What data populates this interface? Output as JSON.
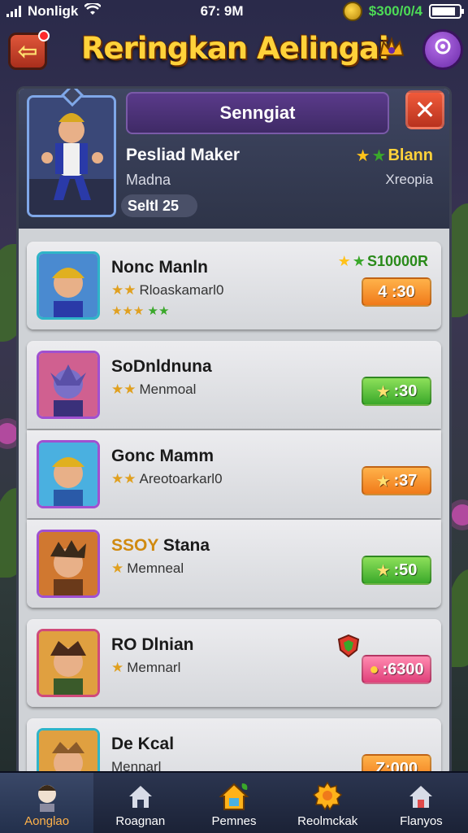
{
  "status_bar": {
    "carrier": "Nonligk",
    "time": "67: 9M",
    "currency": "$300/0/4"
  },
  "header": {
    "title": "Reringkan Aelingai"
  },
  "profile": {
    "banner_name": "Senngiat",
    "title": "Pesliad Maker",
    "subtitle": "Madna",
    "level": "Seltl 25",
    "rank": "Blann",
    "rank_sub": "Xreopia"
  },
  "list": [
    {
      "name": "Nonc Manln",
      "sub": "Rloaskamarl0",
      "timer": "4 :30",
      "timer_color": "orange",
      "reward": "S10000R",
      "frame": "#2fb4c8"
    },
    {
      "name": "SoDnldnuna",
      "sub": "Menmoal",
      "timer": ":30",
      "timer_color": "green",
      "frame": "#a050d0"
    },
    {
      "name": "Gonc Mamm",
      "sub": "Areotoarkarl0",
      "timer": ":37",
      "timer_color": "orange",
      "frame": "#a050d0"
    },
    {
      "name": "Stana",
      "name_prefix": "SSOY",
      "sub": "Memneal",
      "timer": ":50",
      "timer_color": "green",
      "frame": "#a050d0"
    },
    {
      "name": "Dlnian",
      "name_prefix": "RO",
      "sub": "Memnarl",
      "timer": ":6300",
      "timer_color": "pink",
      "frame": "#d04a7a"
    },
    {
      "name": "De Kcal",
      "sub": "Mennarl",
      "timer": "Z:000",
      "timer_color": "orange",
      "frame": "#2fb4c8"
    }
  ],
  "nav": [
    {
      "label": "Aonglao",
      "icon": "avatar-icon"
    },
    {
      "label": "Roagnan",
      "icon": "home-icon"
    },
    {
      "label": "Pemnes",
      "icon": "house-leaf-icon"
    },
    {
      "label": "Reolmckak",
      "icon": "gear-badge-icon"
    },
    {
      "label": "Flanyos",
      "icon": "house-icon"
    }
  ],
  "colors": {
    "accent_gold": "#ffd23a",
    "panel_bg": "#cfd2d6",
    "timer_orange": "#f07a1a",
    "timer_green": "#3aa82a",
    "timer_pink": "#e0407a"
  }
}
